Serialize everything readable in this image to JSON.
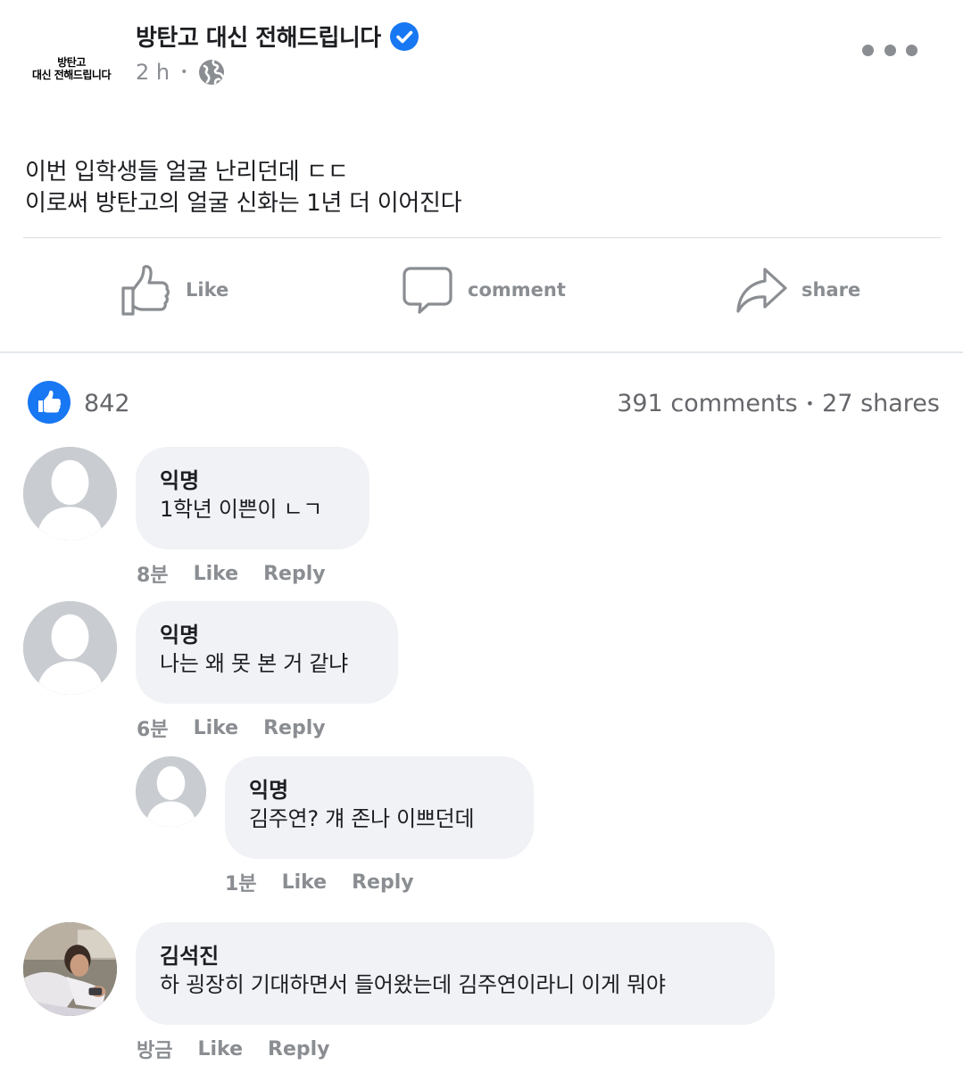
{
  "post": {
    "page_avatar_line1": "방탄고",
    "page_avatar_line2": "대신 전해드립니다",
    "page_name": "방탄고 대신 전해드립니다",
    "time": "2 h",
    "separator": "•",
    "text_line1": "이번 입학생들 얼굴 난리던데 ㄷㄷ",
    "text_line2": "이로써 방탄고의 얼굴 신화는 1년 더 이어진다"
  },
  "actions": {
    "like": "Like",
    "comment": "comment",
    "share": "share"
  },
  "stats": {
    "likes": "842",
    "comments": "391 comments",
    "separator": "•",
    "shares": "27 shares"
  },
  "comments": [
    {
      "author": "익명",
      "text": "1학년 이쁜이 ㄴㄱ",
      "time": "8분",
      "like": "Like",
      "reply": "Reply"
    },
    {
      "author": "익명",
      "text": "나는 왜 못 본 거 같냐",
      "time": "6분",
      "like": "Like",
      "reply": "Reply"
    },
    {
      "author": "익명",
      "text": "김주연? 걔 존나 이쁘던데",
      "time": "1분",
      "like": "Like",
      "reply": "Reply"
    },
    {
      "author": "김석진",
      "text": "하 굉장히 기대하면서 들어왔는데 김주연이라니 이게 뭐야",
      "time": "방금",
      "like": "Like",
      "reply": "Reply"
    }
  ],
  "colors": {
    "accent": "#1877f2",
    "muted": "#8a8d91",
    "bubble": "#f0f2f5"
  },
  "icons": {
    "verified": "verified-badge-icon",
    "audience": "globe-icon",
    "more": "more-dots-icon",
    "like": "thumbs-up-icon",
    "comment": "speech-bubble-icon",
    "share": "share-arrow-icon"
  }
}
